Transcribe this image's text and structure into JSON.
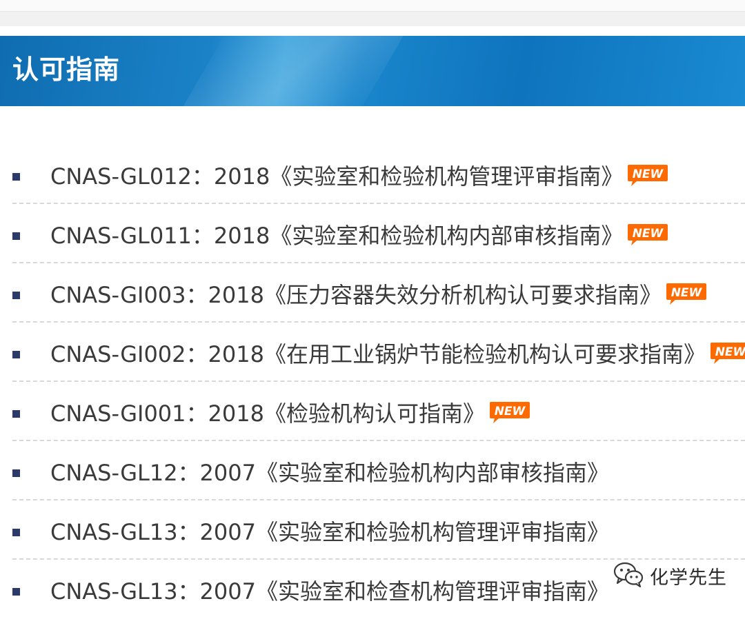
{
  "header": {
    "title": "认可指南"
  },
  "items": [
    {
      "text": "CNAS-GL012：2018《实验室和检验机构管理评审指南》",
      "is_new": true
    },
    {
      "text": "CNAS-GL011：2018《实验室和检验机构内部审核指南》",
      "is_new": true
    },
    {
      "text": "CNAS-GI003：2018《压力容器失效分析机构认可要求指南》",
      "is_new": true
    },
    {
      "text": "CNAS-GI002：2018《在用工业锅炉节能检验机构认可要求指南》",
      "is_new": true
    },
    {
      "text": "CNAS-GI001：2018《检验机构认可指南》",
      "is_new": true
    },
    {
      "text": "CNAS-GL12：2007《实验室和检验机构内部审核指南》",
      "is_new": false
    },
    {
      "text": "CNAS-GL13：2007《实验室和检验机构管理评审指南》",
      "is_new": false
    },
    {
      "text": "CNAS-GL13：2007《实验室和检查机构管理评审指南》",
      "is_new": false
    }
  ],
  "badge": {
    "label": "NEW",
    "color": "#ff6a00"
  },
  "watermark": {
    "text": "化学先生",
    "icon": "wechat-icon"
  },
  "colors": {
    "header_blue": "#1177bf",
    "bullet": "#2c3a6a",
    "text": "#3a3a3a",
    "divider": "#d8d8d8"
  }
}
